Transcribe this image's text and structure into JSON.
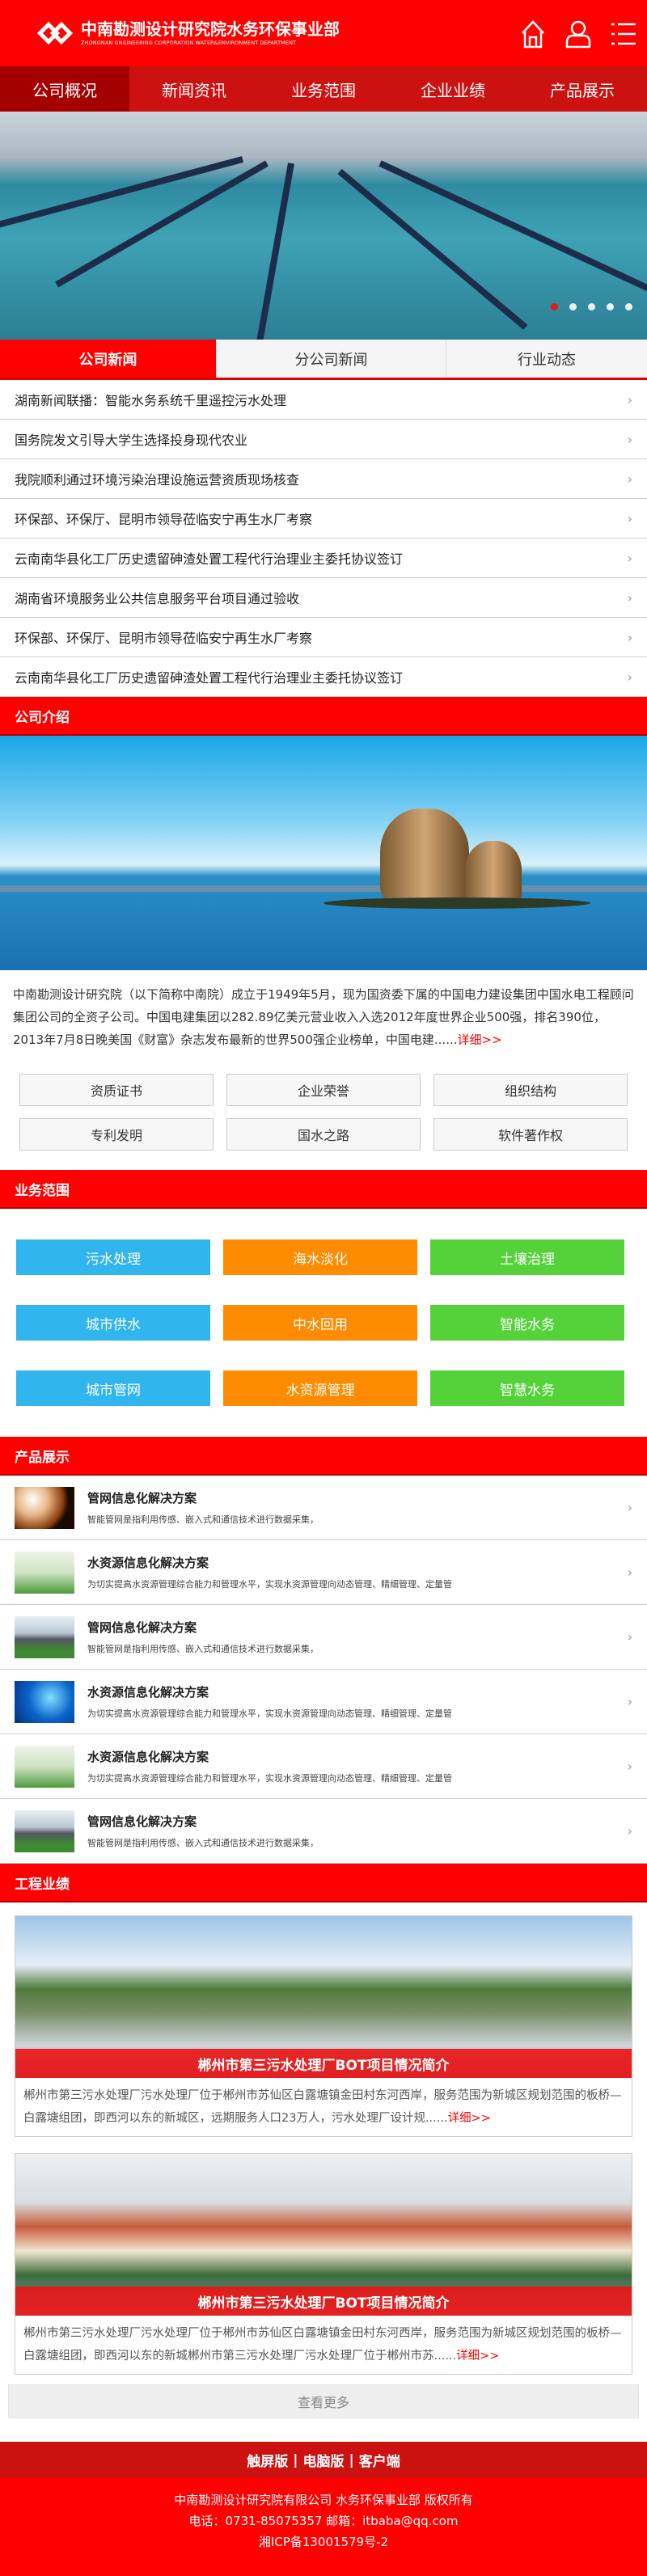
{
  "header": {
    "title_cn": "中南勘测设计研究院水务环保事业部",
    "title_en": "ZHONGNAN GNGINEERING CORPORATION WATER&ENVIRONMENT DEPARTMENT",
    "icons": [
      "home-icon",
      "user-icon",
      "menu-icon"
    ]
  },
  "nav": [
    {
      "label": "公司概况",
      "active": true
    },
    {
      "label": "新闻资讯"
    },
    {
      "label": "业务范围"
    },
    {
      "label": "企业业绩"
    },
    {
      "label": "产品展示"
    }
  ],
  "banner": {
    "slide_count": 5,
    "active_slide": 1
  },
  "news": {
    "tabs": [
      {
        "label": "公司新闻",
        "active": true
      },
      {
        "label": "分公司新闻"
      },
      {
        "label": "行业动态"
      }
    ],
    "items": [
      "湖南新闻联播：智能水务系统千里遥控污水处理",
      "国务院发文引导大学生选择投身现代农业",
      "我院顺利通过环境污染治理设施运营资质现场核查",
      "环保部、环保厅、昆明市领导莅临安宁再生水厂考察",
      "云南南华县化工厂历史遗留砷渣处置工程代行治理业主委托协议签订",
      "湖南省环境服务业公共信息服务平台项目通过验收",
      "环保部、环保厅、昆明市领导莅临安宁再生水厂考察",
      "云南南华县化工厂历史遗留砷渣处置工程代行治理业主委托协议签订"
    ]
  },
  "intro": {
    "heading": "公司介绍",
    "text": "中南勘测设计研究院（以下简称中南院）成立于1949年5月，现为国资委下属的中国电力建设集团中国水电工程顾问集团公司的全资子公司。中国电建集团以282.89亿美元营业收入入选2012年度世界企业500强，排名390位，2013年7月8日晚美国《财富》杂志发布最新的世界500强企业榜单，中国电建......",
    "more": "详细>>",
    "buttons": [
      "资质证书",
      "企业荣誉",
      "组织结构",
      "专利发明",
      "国水之路",
      "软件著作权"
    ]
  },
  "services": {
    "heading": "业务范围",
    "colors": {
      "blue": "#31b5ee",
      "orange": "#ff8c00",
      "green": "#55d23a"
    },
    "items": [
      {
        "label": "污水处理",
        "color": "blue"
      },
      {
        "label": "海水淡化",
        "color": "orange"
      },
      {
        "label": "土壤治理",
        "color": "green"
      },
      {
        "label": "城市供水",
        "color": "blue"
      },
      {
        "label": "中水回用",
        "color": "orange"
      },
      {
        "label": "智能水务",
        "color": "green"
      },
      {
        "label": "城市管网",
        "color": "blue"
      },
      {
        "label": "水资源管理",
        "color": "orange"
      },
      {
        "label": "智慧水务",
        "color": "green"
      }
    ]
  },
  "products": {
    "heading": "产品展示",
    "items": [
      {
        "title": "管网信息化解决方案",
        "desc": "智能管网是指利用传感、嵌入式和通信技术进行数据采集，",
        "thumb": "pipes"
      },
      {
        "title": "水资源信息化解决方案",
        "desc": "为切实提高水资源管理综合能力和管理水平，实现水资源管理向动态管理、精细管理、定量管",
        "thumb": "nature"
      },
      {
        "title": "管网信息化解决方案",
        "desc": "智能管网是指利用传感、嵌入式和通信技术进行数据采集，",
        "thumb": "plant"
      },
      {
        "title": "水资源信息化解决方案",
        "desc": "为切实提高水资源管理综合能力和管理水平，实现水资源管理向动态管理、精细管理、定量管",
        "thumb": "network"
      },
      {
        "title": "水资源信息化解决方案",
        "desc": "为切实提高水资源管理综合能力和管理水平，实现水资源管理向动态管理、精细管理、定量管",
        "thumb": "nature"
      },
      {
        "title": "管网信息化解决方案",
        "desc": "智能管网是指利用传感、嵌入式和通信技术进行数据采集，",
        "thumb": "plant"
      }
    ]
  },
  "projects": {
    "heading": "工程业绩",
    "items": [
      {
        "title": "郴州市第三污水处理厂BOT项目情况简介",
        "text": "郴州市第三污水处理厂污水处理厂位于郴州市苏仙区白露塘镇金田村东河西岸，服务范围为新城区规划范围的板桥—白露塘组团，即西河以东的新城区，远期服务人口23万人，污水处理厂设计规......",
        "more": "详细>>"
      },
      {
        "title": "郴州市第三污水处理厂BOT项目情况简介",
        "text": "郴州市第三污水处理厂污水处理厂位于郴州市苏仙区白露塘镇金田村东河西岸，服务范围为新城区规划范围的板桥—白露塘组团，即西河以东的新城郴州市第三污水处理厂污水处理厂位于郴州市苏......",
        "more": "详细>>"
      }
    ],
    "see_more": "查看更多"
  },
  "footer": {
    "links": [
      "触屏版",
      "|",
      "电脑版",
      "|",
      "客户端"
    ],
    "copyright": "中南勘测设计研究院有限公司 水务环保事业部 版权所有",
    "contact": "电话：0731-85075357 邮箱：itbaba@qq.com",
    "icp": "湘ICP备13001579号-2"
  }
}
